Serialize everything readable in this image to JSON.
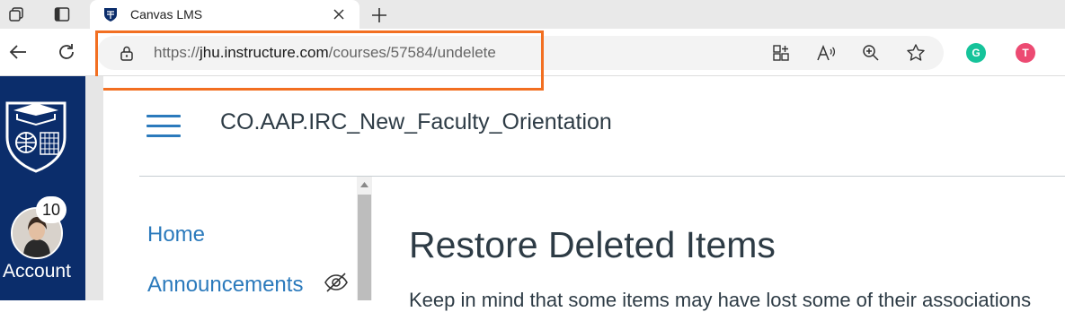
{
  "browser": {
    "tab": {
      "title": "Canvas LMS",
      "favicon": "jhu-shield-icon"
    },
    "address": {
      "scheme": "https://",
      "host": "jhu.instructure.com",
      "path": "/courses/57584/undelete"
    },
    "extensions": [
      {
        "name": "grammarly-extension-icon",
        "letter": "G",
        "color": "#15c39a"
      },
      {
        "name": "tracker-extension-icon",
        "letter": "T",
        "color": "#ec4a72"
      }
    ],
    "highlight_color": "#f26f21"
  },
  "global_nav": {
    "account_label": "Account",
    "notification_count": "10",
    "background": "#0b2d6b"
  },
  "course": {
    "title": "CO.AAP.IRC_New_Faculty_Orientation",
    "nav_items": [
      {
        "label": "Home"
      },
      {
        "label": "Announcements",
        "hidden_indicator": "eye-slash-icon"
      }
    ]
  },
  "main": {
    "heading": "Restore Deleted Items",
    "intro": "Keep in mind that some items may have lost some of their associations"
  }
}
